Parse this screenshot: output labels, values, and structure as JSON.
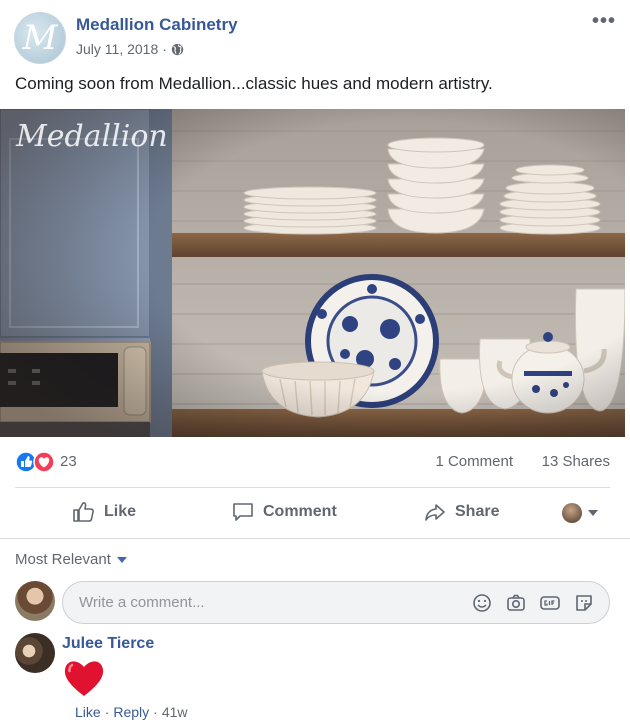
{
  "post": {
    "page_name": "Medallion Cabinetry",
    "avatar_letter": "M",
    "date": "July 11, 2018",
    "separator": "·",
    "more_label": "•••",
    "text": "Coming soon from Medallion...classic hues and modern artistry.",
    "image_watermark": "Medallion"
  },
  "stats": {
    "reaction_count": "23",
    "comments": "1 Comment",
    "shares": "13 Shares"
  },
  "actions": {
    "like": "Like",
    "comment": "Comment",
    "share": "Share"
  },
  "comments_section": {
    "sort_label": "Most Relevant",
    "composer_placeholder": "Write a comment...",
    "items": [
      {
        "author": "Julee Tierce",
        "like_link": "Like",
        "reply_link": "Reply",
        "age": "41w"
      }
    ]
  },
  "colors": {
    "link_blue": "#385898",
    "like_blue": "#1877f2",
    "love_red": "#f33e58",
    "meta_gray": "#606770"
  }
}
